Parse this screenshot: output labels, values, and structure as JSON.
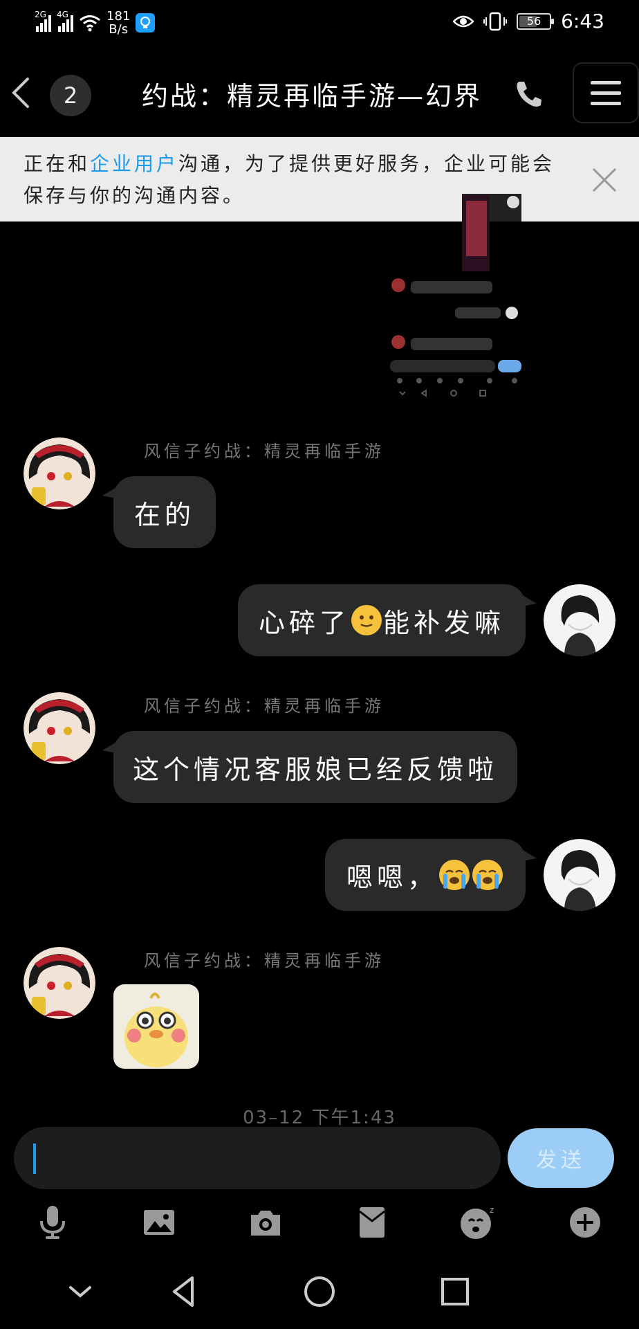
{
  "status_bar": {
    "signal1_label": "2G",
    "signal2_label": "4G",
    "net_speed_value": "181",
    "net_speed_unit": "B/s",
    "battery": "56",
    "time": "6:43"
  },
  "header": {
    "unread_count": "2",
    "title": "约战：精灵再临手游—幻界"
  },
  "notice": {
    "prefix": "正在和",
    "highlight": "企业用户",
    "suffix": "沟通，为了提供更好服务，企业可能会保存与你的沟通内容。"
  },
  "messages": [
    {
      "sender": "风信子约战：精灵再临手游",
      "text": "在的"
    },
    {
      "text_a": "心碎了",
      "text_b": "能补发嘛"
    },
    {
      "sender": "风信子约战：精灵再临手游",
      "text": "这个情况客服娘已经反馈啦"
    },
    {
      "text": "嗯嗯，"
    },
    {
      "sender": "风信子约战：精灵再临手游"
    }
  ],
  "timestamp": "03–12 下午1:43",
  "input": {
    "send_label": "发送"
  },
  "icons": {
    "toolbar": [
      "microphone-icon",
      "image-icon",
      "camera-icon",
      "red-packet-icon",
      "sticker-icon",
      "plus-icon"
    ],
    "navbar": [
      "hide-keyboard-icon",
      "back-triangle-icon",
      "home-circle-icon",
      "recents-square-icon"
    ]
  },
  "colors": {
    "background": "#000000",
    "bubble": "#2a2a2a",
    "accent": "#1b9bec",
    "send_button": "#9bcdf7"
  }
}
